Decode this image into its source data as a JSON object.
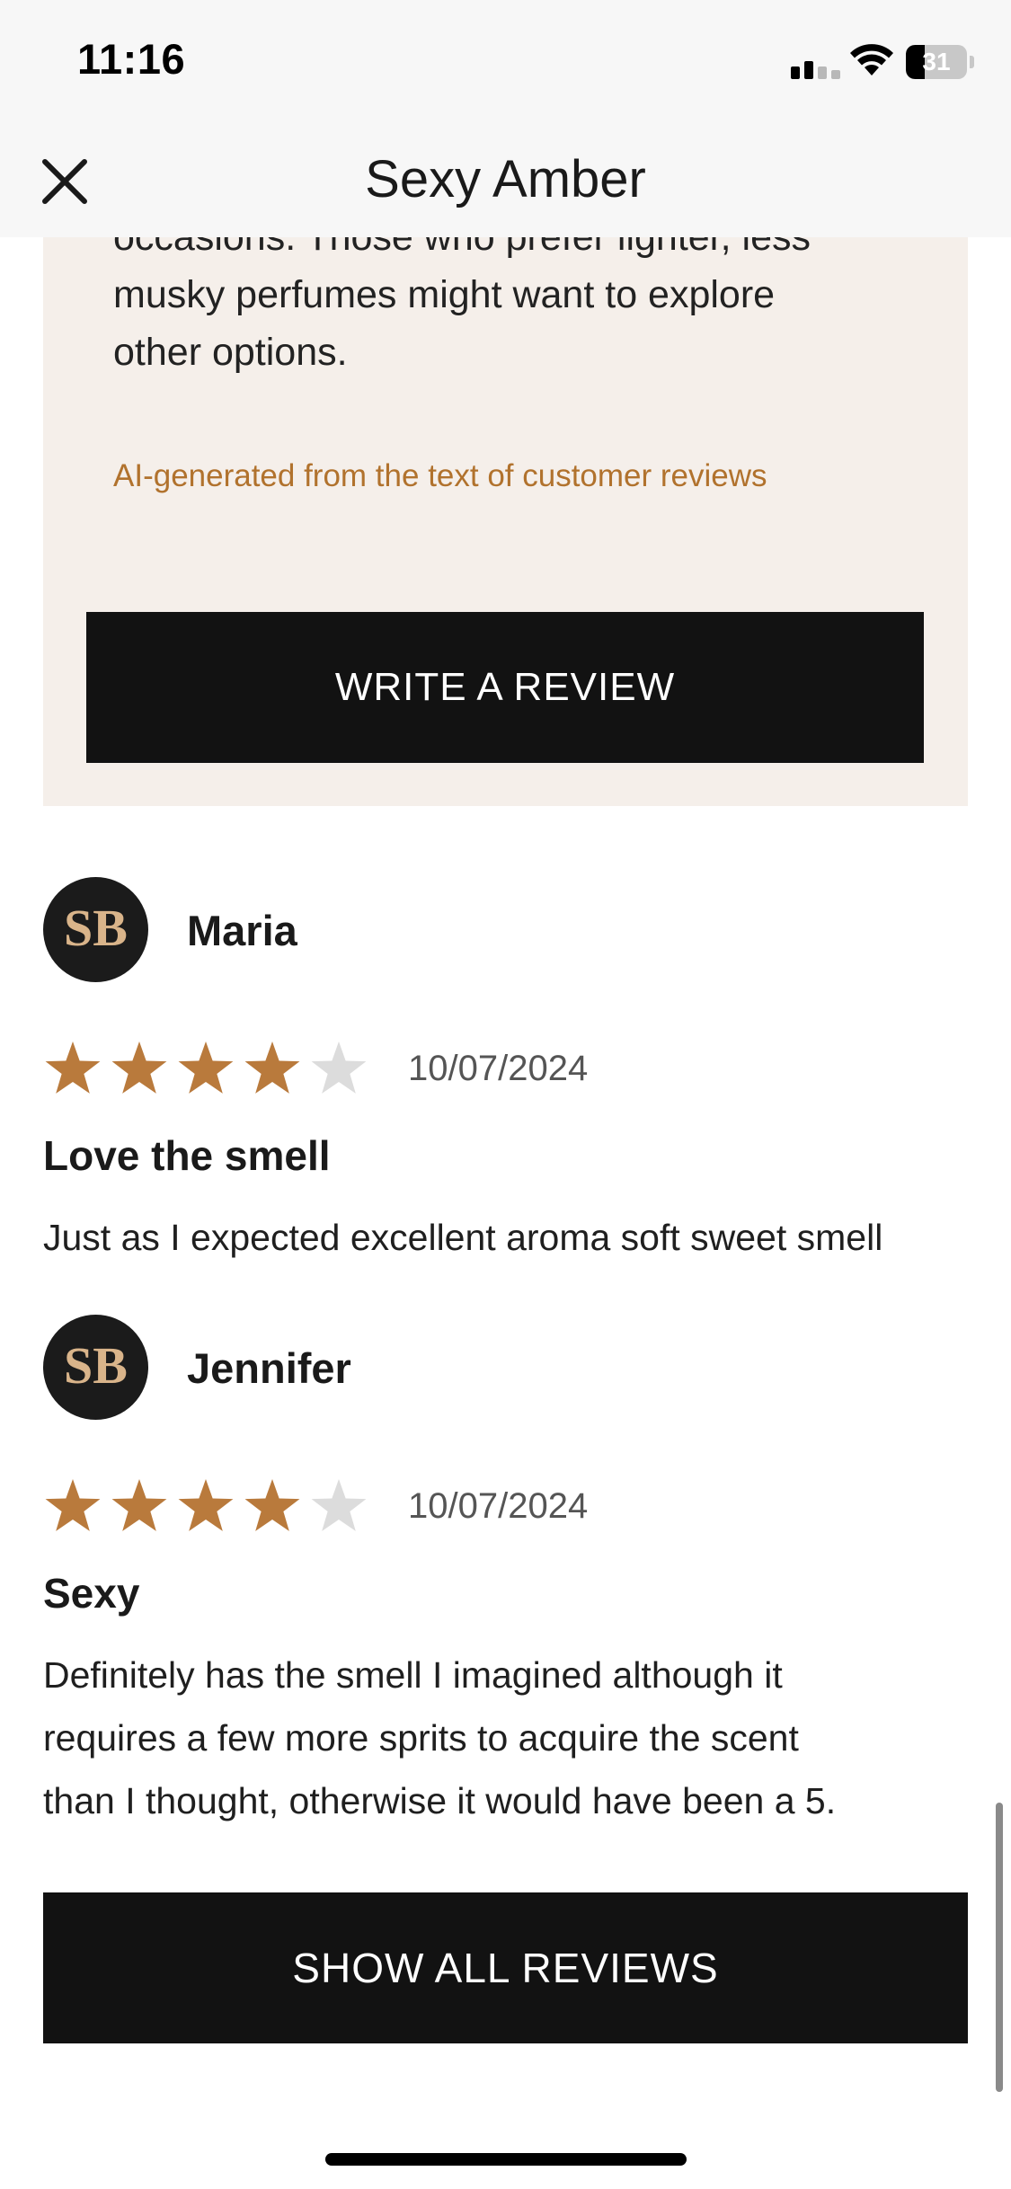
{
  "status_bar": {
    "time": "11:16",
    "battery_level": "31",
    "battery_fraction": 0.31
  },
  "header": {
    "title": "Sexy Amber",
    "close_icon": "close-icon"
  },
  "summary": {
    "lines": [
      "occasions. Those who prefer lighter, less",
      "musky perfumes might want to explore",
      "other options."
    ],
    "ai_note": "AI-generated from the text of customer reviews",
    "write_review_label": "WRITE A REVIEW"
  },
  "colors": {
    "accent": "#b1722d",
    "star_filled": "#b97a3c",
    "star_empty": "#dcdcdc",
    "card_bg": "#f5efea",
    "button_bg": "#121212"
  },
  "reviews": [
    {
      "name": "Maria",
      "rating": 4,
      "max_rating": 5,
      "date": "10/07/2024",
      "title": "Love the smell",
      "body_lines": [
        "Just as I expected excellent aroma soft sweet smell"
      ]
    },
    {
      "name": "Jennifer",
      "rating": 4,
      "max_rating": 5,
      "date": "10/07/2024",
      "title": "Sexy",
      "body_lines": [
        "Definitely has the smell I imagined although it",
        "requires a few more sprits to acquire the scent",
        "than I thought, otherwise it would have been a 5."
      ]
    }
  ],
  "show_all_label": "SHOW ALL REVIEWS"
}
